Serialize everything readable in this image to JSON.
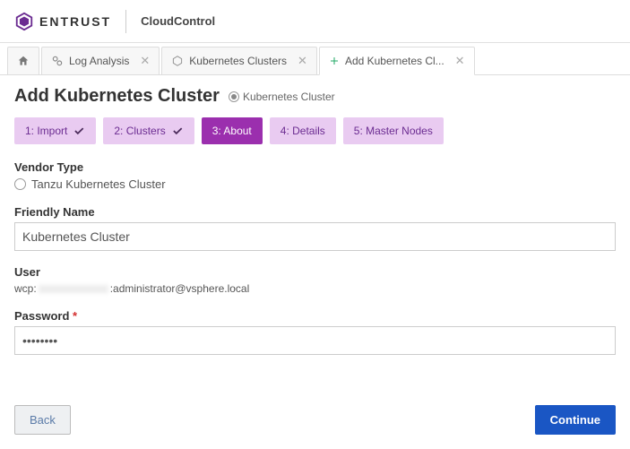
{
  "header": {
    "brand": "ENTRUST",
    "product": "CloudControl"
  },
  "tabs": {
    "items": [
      {
        "label": "",
        "icon": "home",
        "closable": false
      },
      {
        "label": "Log Analysis",
        "icon": "analysis",
        "closable": true
      },
      {
        "label": "Kubernetes Clusters",
        "icon": "kube",
        "closable": true
      },
      {
        "label": "Add Kubernetes Cl...",
        "icon": "plus",
        "closable": true,
        "active": true
      }
    ]
  },
  "page": {
    "title": "Add Kubernetes Cluster",
    "badge": "Kubernetes Cluster"
  },
  "wizard": {
    "steps": [
      {
        "label": "1: Import",
        "checked": true
      },
      {
        "label": "2: Clusters",
        "checked": true
      },
      {
        "label": "3: About",
        "active": true
      },
      {
        "label": "4: Details"
      },
      {
        "label": "5: Master Nodes"
      }
    ]
  },
  "form": {
    "vendor_type_label": "Vendor Type",
    "vendor_option": "Tanzu Kubernetes Cluster",
    "friendly_name_label": "Friendly Name",
    "friendly_name_value": "Kubernetes Cluster",
    "user_label": "User",
    "user_prefix": "wcp:",
    "user_suffix": ":administrator@vsphere.local",
    "password_label": "Password",
    "password_value": "••••••••"
  },
  "buttons": {
    "back": "Back",
    "continue": "Continue"
  }
}
